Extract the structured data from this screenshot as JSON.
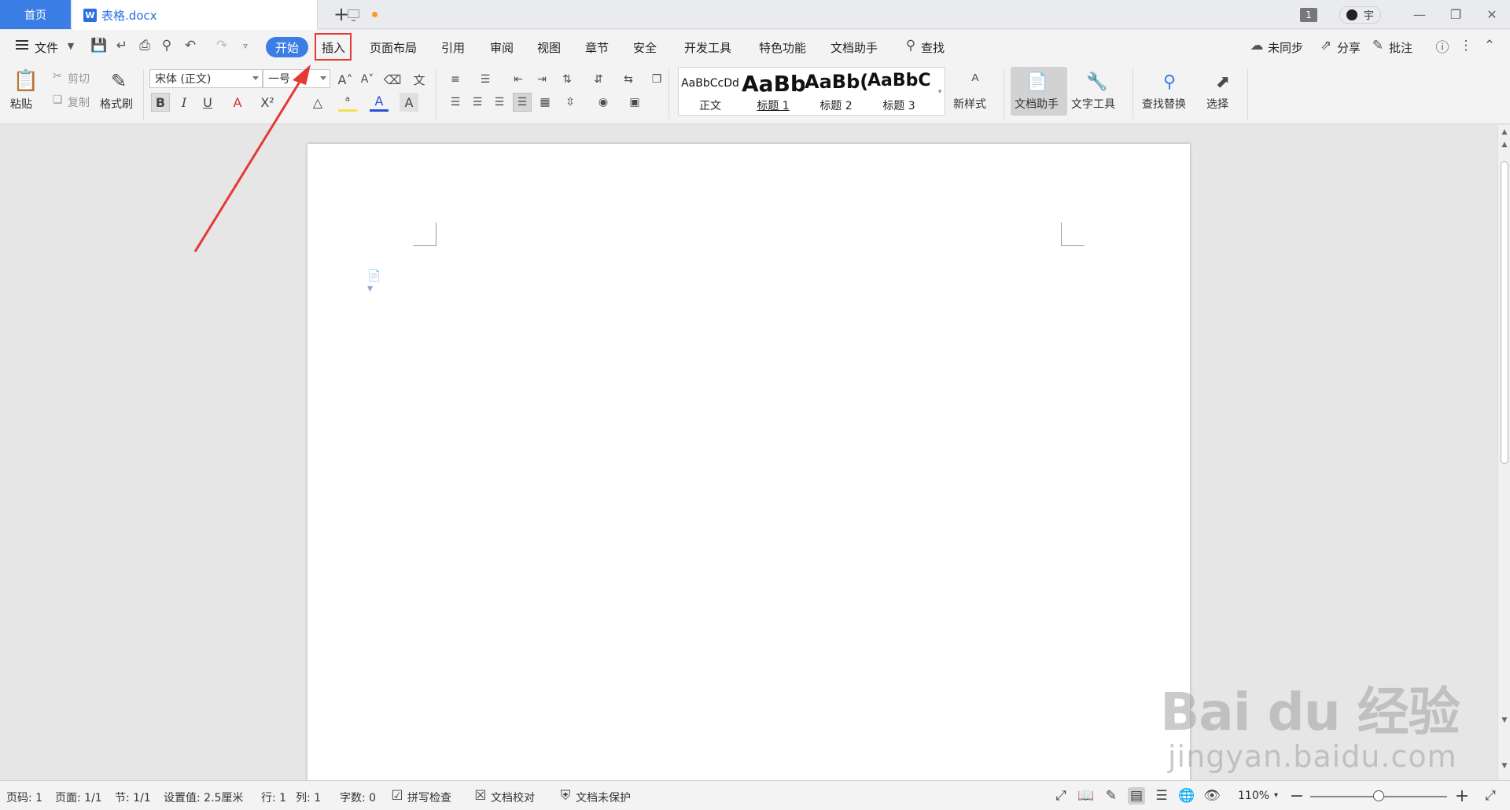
{
  "tabbar": {
    "home_label": "首页",
    "doc_name": "表格.docx",
    "doc_icon_letter": "W",
    "new_tab_icon": "+",
    "window_count": "1",
    "user_name": "宇"
  },
  "menu": {
    "file_label": "文件",
    "tabs": [
      "开始",
      "插入",
      "页面布局",
      "引用",
      "审阅",
      "视图",
      "章节",
      "安全",
      "开发工具",
      "特色功能",
      "文档助手"
    ],
    "search_label": "查找",
    "sync_label": "未同步",
    "share_label": "分享",
    "comment_label": "批注"
  },
  "ribbon": {
    "paste": "粘贴",
    "cut": "剪切",
    "copy": "复制",
    "format_painter": "格式刷",
    "font_name": "宋体 (正文)",
    "font_size": "一号",
    "styles": [
      {
        "sample": "AaBbCcDd",
        "label": "正文"
      },
      {
        "sample": "AaBb",
        "label": "标题 1"
      },
      {
        "sample": "AaBb(",
        "label": "标题 2"
      },
      {
        "sample": "AaBbC(",
        "label": "标题 3"
      }
    ],
    "new_style": "新样式",
    "doc_assistant": "文档助手",
    "text_tools": "文字工具",
    "find_replace": "查找替换",
    "select": "选择"
  },
  "status": {
    "page_no": "页码: 1",
    "pages": "页面: 1/1",
    "section": "节: 1/1",
    "setting": "设置值: 2.5厘米",
    "row": "行: 1",
    "col": "列: 1",
    "words": "字数: 0",
    "spell_check": "拼写检查",
    "doc_proof": "文档校对",
    "doc_protect": "文档未保护",
    "zoom": "110%"
  },
  "watermark": {
    "brand": "Bai du 经验",
    "url": "jingyan.baidu.com"
  },
  "colors": {
    "accent": "#3a7ee5",
    "highlight_box": "#e53935",
    "annotation_arrow": "#e53935"
  }
}
